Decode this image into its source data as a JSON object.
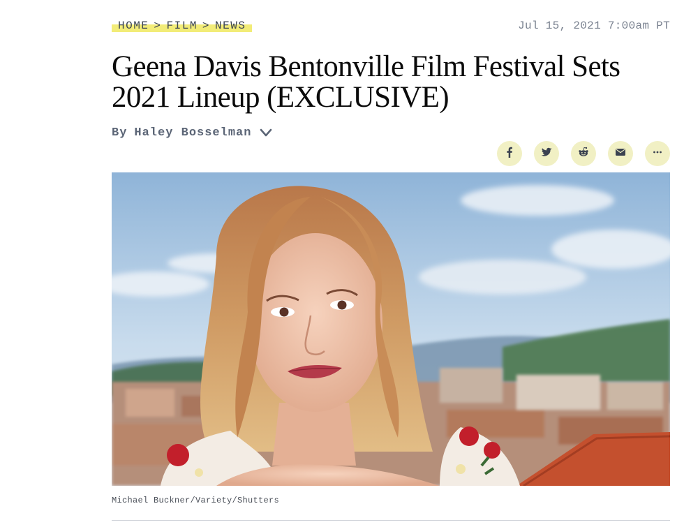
{
  "breadcrumb": {
    "items": [
      "HOME",
      "FILM",
      "NEWS"
    ],
    "separator": ">"
  },
  "dateline": "Jul 15, 2021 7:00am PT",
  "article": {
    "headline": "Geena Davis Bentonville Film Festival Sets 2021 Lineup (EXCLUSIVE)",
    "byline_prefix": "By",
    "author": "Haley Bosselman",
    "image_credit": "Michael Buckner/Variety/Shutters"
  },
  "share": {
    "buttons": [
      {
        "name": "facebook-icon"
      },
      {
        "name": "twitter-icon"
      },
      {
        "name": "reddit-icon"
      },
      {
        "name": "email-icon"
      },
      {
        "name": "more-icon"
      }
    ]
  },
  "colors": {
    "highlight": "#f2ec78",
    "share_bg": "#f1f0c4",
    "meta_text": "#5b6576"
  }
}
